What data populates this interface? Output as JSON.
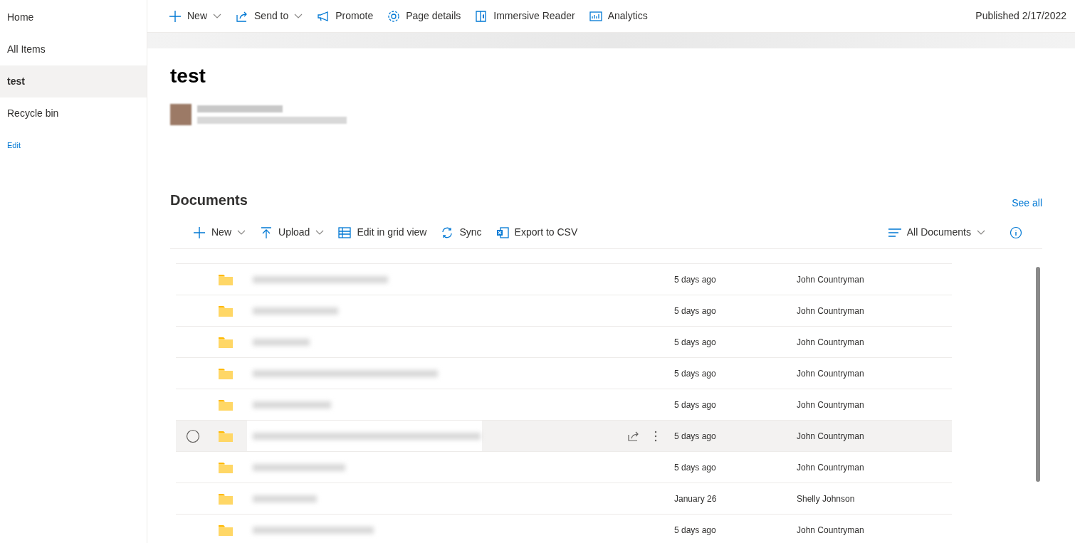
{
  "sidebar": {
    "items": [
      {
        "label": "Home",
        "selected": false
      },
      {
        "label": "All Items",
        "selected": false
      },
      {
        "label": "test",
        "selected": true
      },
      {
        "label": "Recycle bin",
        "selected": false
      }
    ],
    "edit_link": "Edit"
  },
  "command_bar": {
    "items": [
      {
        "label": "New",
        "kind": "plus",
        "dropdown": true
      },
      {
        "label": "Send to",
        "kind": "share",
        "dropdown": true
      },
      {
        "label": "Promote",
        "kind": "megaphone",
        "dropdown": false
      },
      {
        "label": "Page details",
        "kind": "gear",
        "dropdown": false
      },
      {
        "label": "Immersive Reader",
        "kind": "reader",
        "dropdown": false
      },
      {
        "label": "Analytics",
        "kind": "chart",
        "dropdown": false
      }
    ],
    "status": "Published 2/17/2022"
  },
  "page": {
    "title": "test"
  },
  "documents": {
    "title": "Documents",
    "see_all": "See all",
    "toolbar": [
      {
        "label": "New",
        "kind": "plus",
        "dropdown": true
      },
      {
        "label": "Upload",
        "kind": "upload",
        "dropdown": true
      },
      {
        "label": "Edit in grid view",
        "kind": "grid",
        "dropdown": false
      },
      {
        "label": "Sync",
        "kind": "sync",
        "dropdown": false
      },
      {
        "label": "Export to CSV",
        "kind": "excel",
        "dropdown": false
      }
    ],
    "view": "All Documents",
    "rows": [
      {
        "modified": "5 days ago",
        "modified_by": "John Countryman",
        "highlighted": false
      },
      {
        "modified": "5 days ago",
        "modified_by": "John Countryman",
        "highlighted": false
      },
      {
        "modified": "5 days ago",
        "modified_by": "John Countryman",
        "highlighted": false
      },
      {
        "modified": "5 days ago",
        "modified_by": "John Countryman",
        "highlighted": false
      },
      {
        "modified": "5 days ago",
        "modified_by": "John Countryman",
        "highlighted": false
      },
      {
        "modified": "5 days ago",
        "modified_by": "John Countryman",
        "highlighted": true
      },
      {
        "modified": "5 days ago",
        "modified_by": "John Countryman",
        "highlighted": false
      },
      {
        "modified": "January 26",
        "modified_by": "Shelly Johnson",
        "highlighted": false
      },
      {
        "modified": "5 days ago",
        "modified_by": "John Countryman",
        "highlighted": false
      }
    ]
  }
}
